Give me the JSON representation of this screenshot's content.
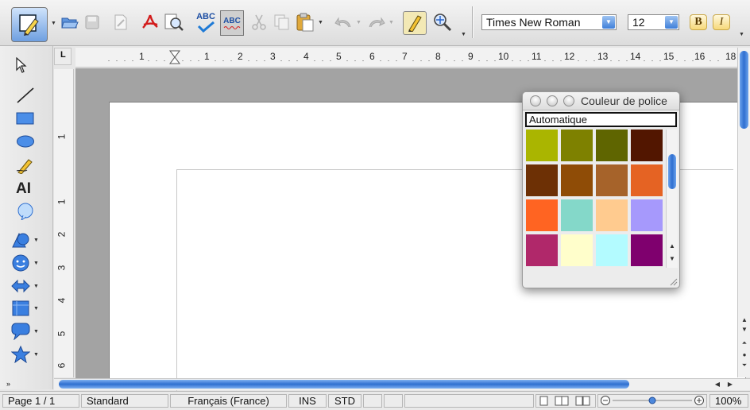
{
  "toolbar": {
    "buttons": [
      "draw-functions-icon",
      "open-icon",
      "save-icon",
      "edit-file-icon",
      "export-pdf-icon",
      "page-preview-icon",
      "spellcheck-icon",
      "autospellcheck-icon",
      "cut-icon",
      "copy-icon",
      "paste-icon",
      "undo-icon",
      "redo-icon",
      "show-draw-functions-icon",
      "navigator-icon"
    ],
    "font_name": "Times New Roman",
    "font_size": "12",
    "bold_label": "B",
    "italic_label": "I",
    "spell_abc": "ABC"
  },
  "drawbar": {
    "tools": [
      "select-icon",
      "line-icon",
      "rectangle-icon",
      "ellipse-icon",
      "freeform-icon",
      "text-icon",
      "callout-icon",
      "basic-shapes-icon",
      "symbol-shapes-icon",
      "block-arrows-icon",
      "flowchart-icon",
      "callouts-icon",
      "stars-icon"
    ],
    "text_tool_label": "AI"
  },
  "ruler": {
    "h_numbers": [
      "1",
      "1",
      "2",
      "3",
      "4",
      "5",
      "6",
      "7",
      "8",
      "9",
      "10",
      "11",
      "12",
      "13",
      "14",
      "15",
      "16",
      "18"
    ],
    "v_numbers": [
      "1",
      "1",
      "2",
      "3",
      "4",
      "5",
      "6"
    ],
    "corner_label": "L"
  },
  "palette": {
    "title": "Couleur de police",
    "auto_label": "Automatique",
    "colors": [
      [
        "#aab500",
        "#7e8100",
        "#5f6500",
        "#521600"
      ],
      [
        "#6d3005",
        "#8f4c06",
        "#a6632a",
        "#e56323"
      ],
      [
        "#ff6422",
        "#84d8c9",
        "#ffcb8f",
        "#a699fc"
      ],
      [
        "#b0286a",
        "#fffecb",
        "#b3fbff",
        "#7f006e"
      ]
    ]
  },
  "status": {
    "page": "Page 1 / 1",
    "style": "Standard",
    "language": "Français (France)",
    "insert_mode": "INS",
    "selection_mode": "STD",
    "zoom": "100%"
  },
  "colors": {
    "accent_blue": "#2f6fd0",
    "page_background": "#a3a3a3"
  }
}
